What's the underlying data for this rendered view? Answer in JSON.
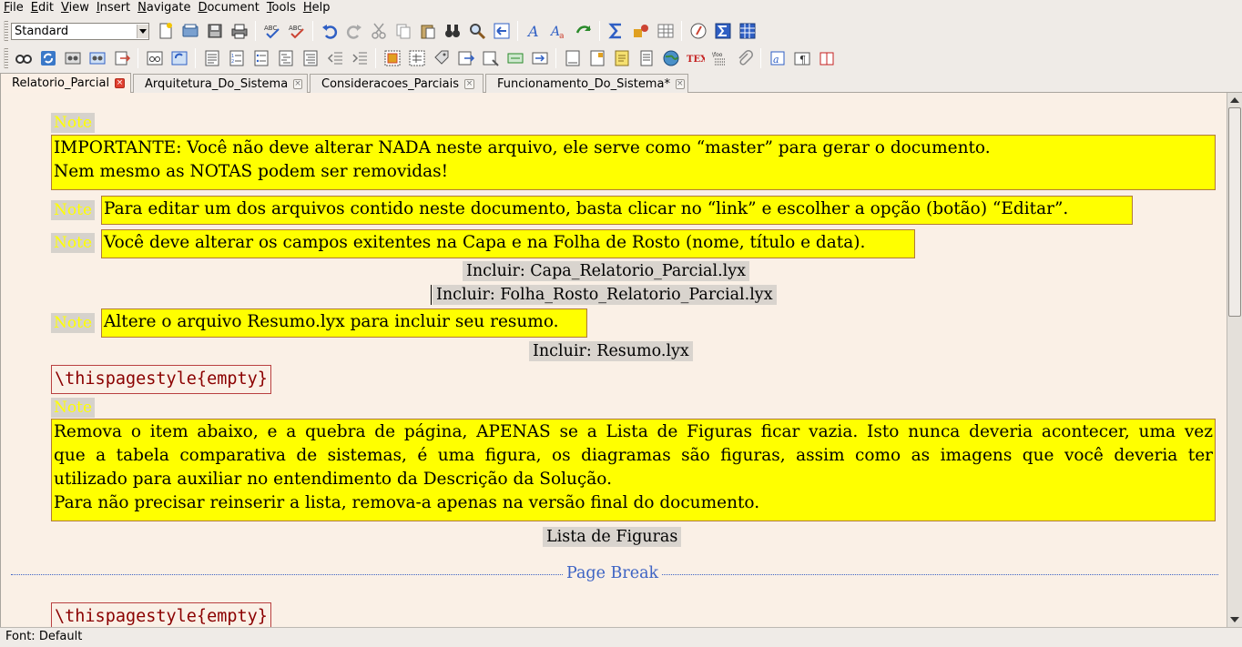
{
  "menubar": {
    "items": [
      {
        "mnemonic": "F",
        "rest": "ile"
      },
      {
        "mnemonic": "E",
        "rest": "dit"
      },
      {
        "mnemonic": "V",
        "rest": "iew"
      },
      {
        "mnemonic": "I",
        "rest": "nsert"
      },
      {
        "mnemonic": "N",
        "rest": "avigate"
      },
      {
        "mnemonic": "D",
        "rest": "ocument"
      },
      {
        "mnemonic": "T",
        "rest": "ools"
      },
      {
        "mnemonic": "H",
        "rest": "elp"
      }
    ]
  },
  "toolbar": {
    "layout_value": "Standard"
  },
  "tabs": [
    {
      "label": "Relatorio_Parcial",
      "active": true
    },
    {
      "label": "Arquitetura_Do_Sistema",
      "active": false
    },
    {
      "label": "Consideracoes_Parciais",
      "active": false
    },
    {
      "label": "Funcionamento_Do_Sistema*",
      "active": false
    }
  ],
  "document": {
    "note_label": "Note",
    "note1_line1": "IMPORTANTE: Você não deve alterar NADA neste arquivo, ele serve como “master” para gerar o documento.",
    "note1_line2": "Nem mesmo as NOTAS podem ser removidas!",
    "note2": "Para editar um dos arquivos contido neste documento, basta clicar no “link” e escolher a opção (botão) “Editar”.",
    "note3": "Você deve alterar os campos exitentes na Capa e na Folha de Rosto (nome, título e data).",
    "include1": "Incluir: Capa_Relatorio_Parcial.lyx",
    "include2": "Incluir: Folha_Rosto_Relatorio_Parcial.lyx",
    "note4": "Altere o arquivo Resumo.lyx para incluir seu resumo.",
    "include3": "Incluir: Resumo.lyx",
    "ert1": "\\thispagestyle{empty}",
    "note5_line1": "Remova o item abaixo, e a quebra de página, APENAS se a Lista de Figuras ficar vazia. Isto nunca deveria acontecer, uma vez",
    "note5_line2": "que a tabela comparativa de sistemas, é uma figura, os diagramas são figuras, assim como as imagens que você deveria ter",
    "note5_line3": "utilizado para auxiliar no entendimento da Descrição da Solução.",
    "note5_line4": "Para não precisar reinserir a lista, remova-a apenas na versão final do documento.",
    "list_of_figures": "Lista de Figuras",
    "page_break": "Page Break",
    "ert2": "\\thispagestyle{empty}"
  },
  "statusbar": {
    "text": "Font: Default"
  }
}
